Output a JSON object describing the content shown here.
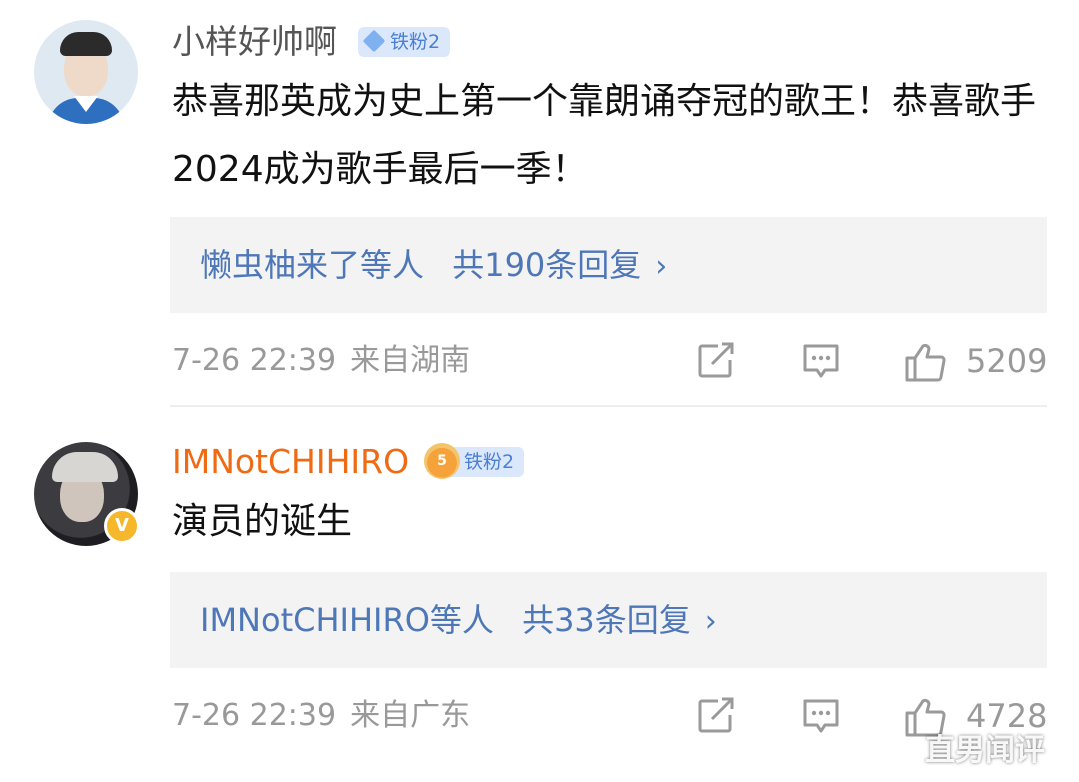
{
  "comments": [
    {
      "username": "小样好帅啊",
      "fan_badge": "铁粉2",
      "content": "恭喜那英成为史上第一个靠朗诵夺冠的歌王！恭喜歌手2024成为歌手最后一季！",
      "replies": {
        "users": "懒虫柚来了",
        "sep": "等人",
        "count": "共190条回复",
        "chevron": "›"
      },
      "time": "7-26 22:39",
      "location": "来自湖南",
      "likes": "5209"
    },
    {
      "username": "IMNotCHIHIRO",
      "fan_badge": "铁粉2",
      "crown_level": "5",
      "verified_mark": "V",
      "content": "演员的诞生",
      "replies": {
        "users": "IMNotCHIHIRO",
        "sep": "等人",
        "count": "共33条回复",
        "chevron": "›"
      },
      "time": "7-26 22:39",
      "location": "来自广东",
      "likes": "4728"
    }
  ],
  "watermark": "直男闻评",
  "colors": {
    "username_gray": "#555555",
    "username_orange": "#f06a14",
    "link_blue": "#4e77b8",
    "badge_bg": "#dbe8fb",
    "meta_gray": "#999999",
    "reply_bg": "#f3f3f3"
  },
  "icons": [
    "diamond-icon",
    "crown-icon",
    "verified-icon",
    "share-icon",
    "comment-icon",
    "like-icon",
    "chevron-right-icon"
  ]
}
